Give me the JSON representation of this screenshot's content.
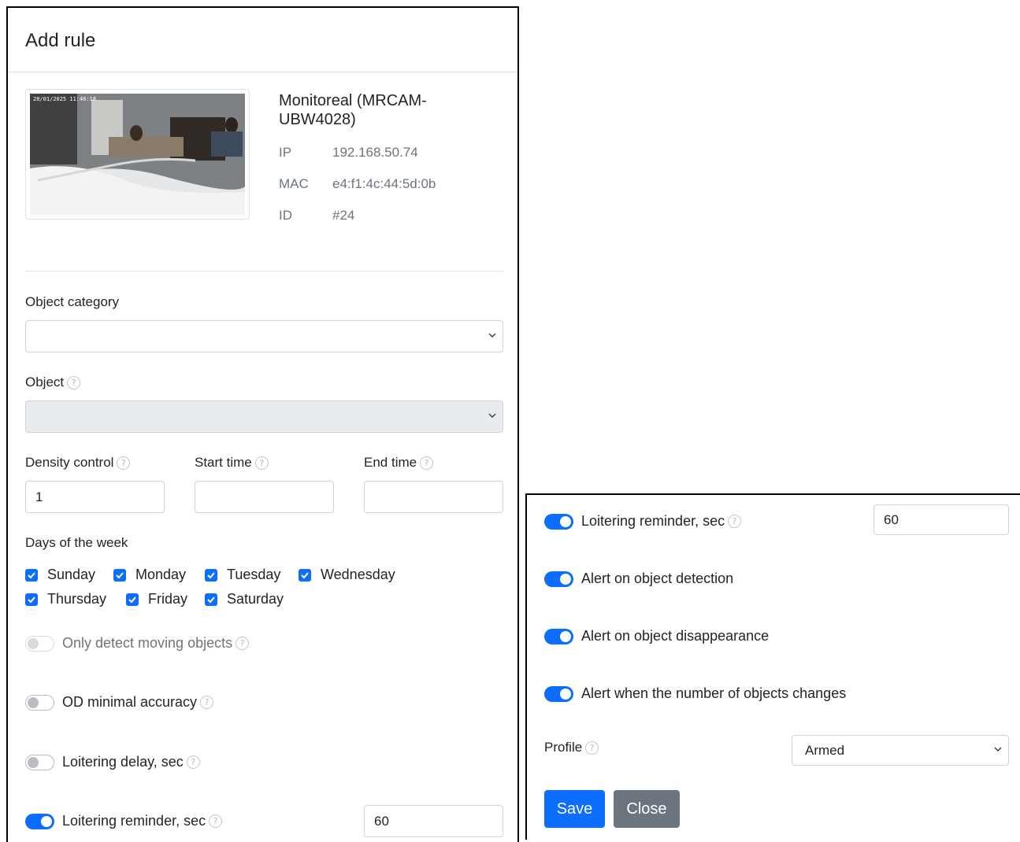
{
  "modal": {
    "title": "Add rule"
  },
  "camera": {
    "name": "Monitoreal (MRCAM-UBW4028)",
    "ip_label": "IP",
    "ip": "192.168.50.74",
    "mac_label": "MAC",
    "mac": "e4:f1:4c:44:5d:0b",
    "id_label": "ID",
    "id": "#24",
    "thumb_timestamp": "28/01/2025 11:46:18"
  },
  "form": {
    "object_category_label": "Object category",
    "object_category_value": "",
    "object_label": "Object",
    "object_value": "",
    "density_label": "Density control",
    "density_value": "1",
    "start_time_label": "Start time",
    "start_time_value": "",
    "end_time_label": "End time",
    "end_time_value": "",
    "days_label": "Days of the week",
    "days": [
      {
        "label": "Sunday",
        "checked": true
      },
      {
        "label": "Monday",
        "checked": true
      },
      {
        "label": "Tuesday",
        "checked": true
      },
      {
        "label": "Wednesday",
        "checked": true
      },
      {
        "label": "Thursday",
        "checked": true
      },
      {
        "label": "Friday",
        "checked": true
      },
      {
        "label": "Saturday",
        "checked": true
      }
    ],
    "only_moving_label": "Only detect moving objects",
    "od_accuracy_label": "OD minimal accuracy",
    "loitering_delay_label": "Loitering delay, sec",
    "loitering_reminder_label": "Loitering reminder, sec",
    "loitering_reminder_value": "60",
    "alert_detection_label": "Alert on object detection",
    "alert_disappearance_label": "Alert on object disappearance",
    "alert_count_label": "Alert when the number of objects changes",
    "profile_label": "Profile",
    "profile_value": "Armed"
  },
  "buttons": {
    "save": "Save",
    "close": "Close"
  },
  "colors": {
    "primary": "#0d6efd",
    "secondary": "#6c757d",
    "border": "#ced4da",
    "disabled_bg": "#e9ecef"
  }
}
